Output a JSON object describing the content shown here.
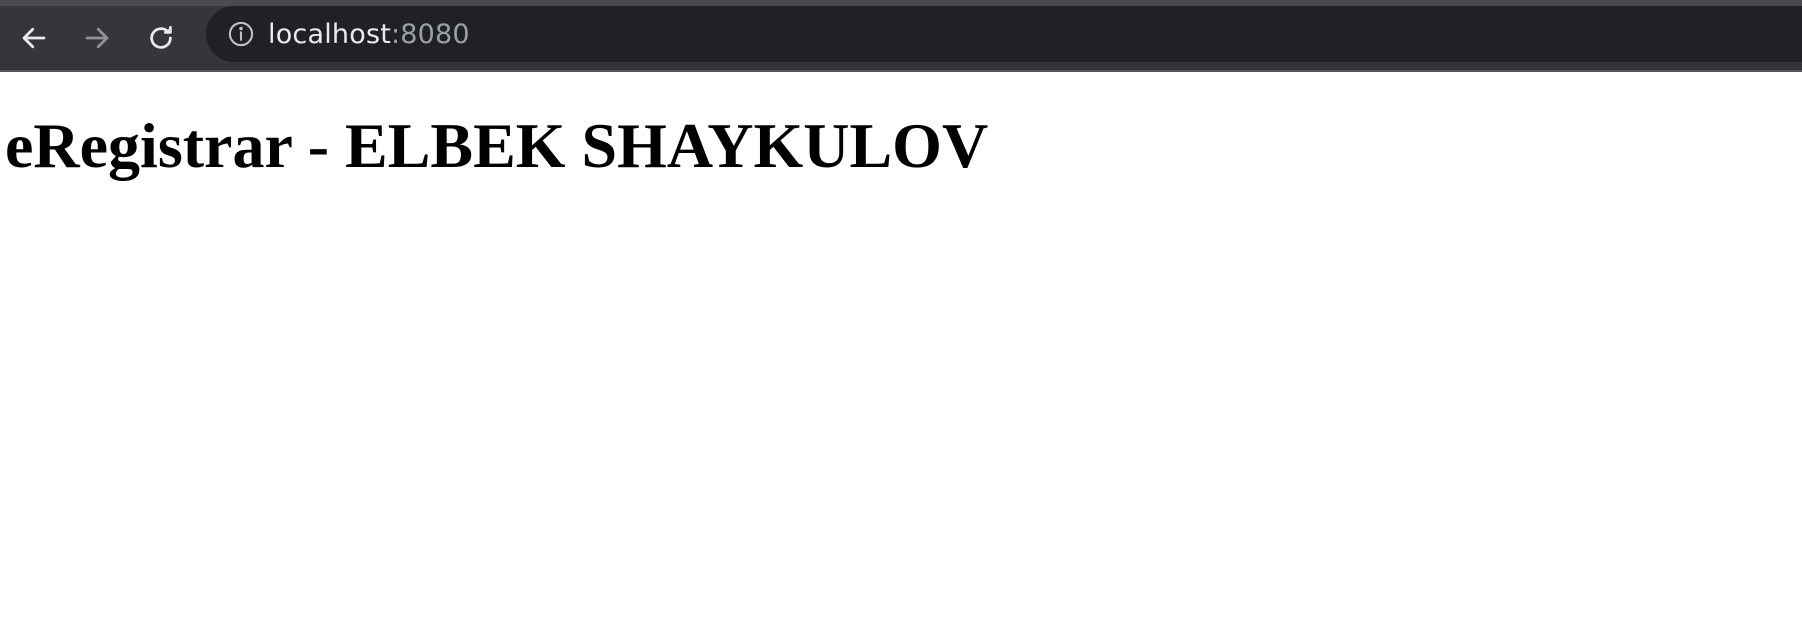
{
  "browser": {
    "nav": {
      "back_icon": "arrow-left-icon",
      "forward_icon": "arrow-right-icon",
      "reload_icon": "reload-icon"
    },
    "address_bar": {
      "security_icon": "info-icon",
      "host": "localhost",
      "port": ":8080"
    }
  },
  "page": {
    "heading": "eRegistrar - ELBEK SHAYKULOV"
  },
  "colors": {
    "toolbar_bg": "#35363a",
    "omnibox_bg": "#202124",
    "url_text": "#e8eaed",
    "url_dim": "#9aa0a6",
    "page_bg": "#ffffff",
    "heading_text": "#000000"
  }
}
